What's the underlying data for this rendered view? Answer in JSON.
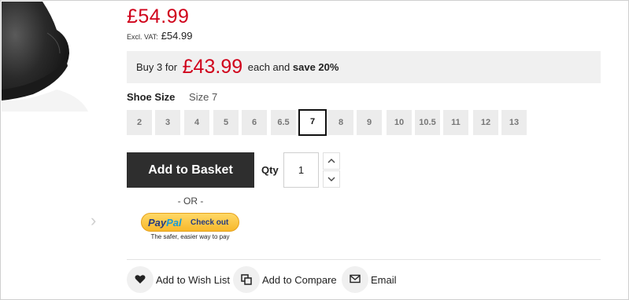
{
  "product": {
    "price": "£54.99",
    "vat_label": "Excl. VAT:",
    "vat_price": "£54.99"
  },
  "promo": {
    "prefix": "Buy 3 for",
    "price": "£43.99",
    "middle": "each and",
    "save": "save 20%"
  },
  "size": {
    "label": "Shoe Size",
    "selected_value": "Size 7",
    "options": [
      "2",
      "3",
      "4",
      "5",
      "6",
      "6.5",
      "7",
      "8",
      "9",
      "10",
      "10.5",
      "11",
      "12",
      "13"
    ]
  },
  "basket": {
    "add_label": "Add to Basket",
    "qty_label": "Qty",
    "qty_value": "1"
  },
  "checkout": {
    "or_text": "- OR -",
    "paypal_pay": "Pay",
    "paypal_pal": "Pal",
    "paypal_checkout": "Check out",
    "paypal_tagline": "The safer, easier way to pay"
  },
  "actions": {
    "wishlist": "Add to Wish List",
    "compare": "Add to Compare",
    "email": "Email"
  },
  "icons": {
    "wishlist": "heart-icon",
    "compare": "compare-icon",
    "email": "envelope-icon",
    "qty_up": "chevron-up-icon",
    "qty_down": "chevron-down-icon",
    "gallery_next": "chevron-right-icon"
  },
  "colors": {
    "price_red": "#d0021b",
    "basket_button": "#2e2e2e",
    "paypal_yellow": "#ffc439",
    "paypal_blue_dark": "#253b80",
    "paypal_blue_light": "#179bd7"
  }
}
